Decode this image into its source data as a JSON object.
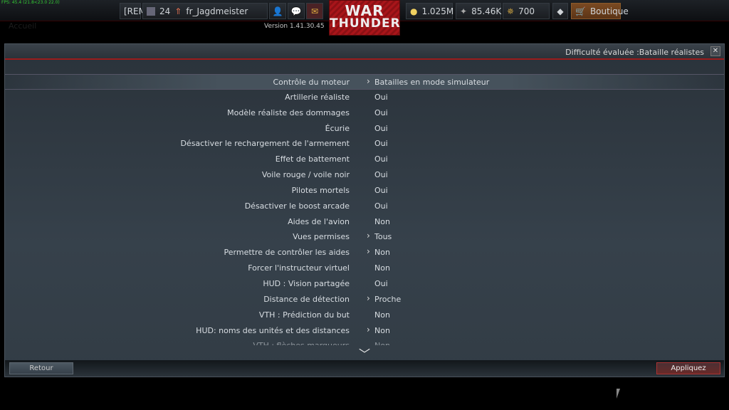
{
  "fps": "FPS: 45.4 (21.8<23.0 22.0)",
  "accueil": "Accueil",
  "topbar": {
    "squad": "[REM]",
    "rank": "24",
    "username": "fr_Jagdmeister",
    "lions": "1.025M",
    "silver": "85.46K",
    "eagles": "700",
    "shop": "Boutique"
  },
  "logo": {
    "line1": "WAR",
    "line2": "THUNDER"
  },
  "version": "Version 1.41.30.45",
  "panel": {
    "title": "Difficulté évaluée :Bataille réalistes",
    "close": "✕"
  },
  "rows": [
    {
      "label": "Contrôle du moteur",
      "value": "Batailles en mode simulateur",
      "chevron": true
    },
    {
      "label": "Artillerie réaliste",
      "value": "Oui",
      "chevron": false
    },
    {
      "label": "Modèle réaliste des dommages",
      "value": "Oui",
      "chevron": false
    },
    {
      "label": "Écurie",
      "value": "Oui",
      "chevron": false
    },
    {
      "label": "Désactiver le rechargement de l'armement",
      "value": "Oui",
      "chevron": false
    },
    {
      "label": "Effet de battement",
      "value": "Oui",
      "chevron": false
    },
    {
      "label": "Voile rouge / voile noir",
      "value": "Oui",
      "chevron": false
    },
    {
      "label": "Pilotes mortels",
      "value": "Oui",
      "chevron": false
    },
    {
      "label": "Désactiver le boost arcade",
      "value": "Oui",
      "chevron": false
    },
    {
      "label": "Aides de l'avion",
      "value": "Non",
      "chevron": false
    },
    {
      "label": "Vues permises",
      "value": "Tous",
      "chevron": true
    },
    {
      "label": "Permettre de contrôler les aides",
      "value": "Non",
      "chevron": true
    },
    {
      "label": "Forcer l'instructeur virtuel",
      "value": "Non",
      "chevron": false
    },
    {
      "label": "HUD : Vision partagée",
      "value": "Oui",
      "chevron": false
    },
    {
      "label": "Distance de détection",
      "value": "Proche",
      "chevron": true
    },
    {
      "label": "VTH : Prédiction du but",
      "value": "Non",
      "chevron": false
    },
    {
      "label": "HUD: noms des unités et des distances",
      "value": "Non",
      "chevron": true
    },
    {
      "label": "VTH : flèches marqueurs",
      "value": "Non",
      "chevron": false
    }
  ],
  "footer": {
    "back": "Retour",
    "apply": "Appliquez"
  }
}
